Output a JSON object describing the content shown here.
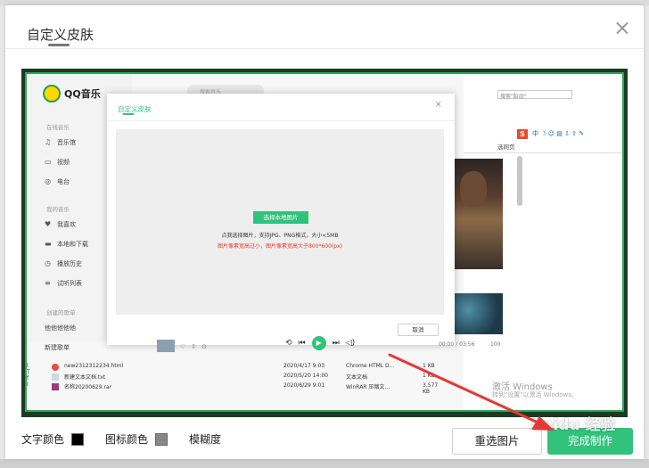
{
  "dialog": {
    "title": "自定义皮肤",
    "close_icon": "close-icon"
  },
  "preview": {
    "qq_logo_text": "QQ音乐",
    "search_placeholder": "搜索音乐",
    "sidebar": {
      "group_online": "在线音乐",
      "items_online": [
        {
          "label": "音乐馆",
          "icon": "music-note-icon"
        },
        {
          "label": "视频",
          "icon": "video-icon"
        },
        {
          "label": "电台",
          "icon": "radio-icon"
        }
      ],
      "group_mine": "我的音乐",
      "items_mine": [
        {
          "label": "我喜欢",
          "icon": "heart-icon"
        },
        {
          "label": "本地和下载",
          "icon": "computer-icon"
        },
        {
          "label": "播放历史",
          "icon": "clock-icon"
        },
        {
          "label": "试听列表",
          "icon": "list-icon"
        }
      ],
      "group_created": "创建的歌单",
      "playlist_1": "他他他他他",
      "playlist_2": "新建歌单"
    },
    "right_panel": {
      "search_text": "搜索\"胎动\"",
      "select_all": "选网页",
      "sogou": "S",
      "toolbar_text": "中 ☽ ☺ ▤ ⇩ ⇧ ✎"
    },
    "inner_modal": {
      "title": "自定义皮肤",
      "upload_button": "选择本地图片",
      "hint": "点我选择图片，支持JPG、PNG格式，大小<5MB",
      "warning": "图片像素宽高过小，图片像素宽高大于800*600(px)",
      "cancel": "取消"
    },
    "player": {
      "time": "00:00 / 03:56",
      "volume": "100"
    },
    "files": [
      {
        "name": "new2312312234.html",
        "date": "2020/4/17 9:03",
        "type": "Chrome HTML D...",
        "size": "1 KB"
      },
      {
        "name": "新建文本文档.txt",
        "date": "2020/5/20 14:00",
        "type": "文本文档",
        "size": "1 KB"
      },
      {
        "name": "名称20200629.rar",
        "date": "2020/6/29 9:01",
        "type": "WinRAR 压缩文...",
        "size": "3,577 KB"
      }
    ],
    "left_labels": [
      "l",
      "T",
      "f",
      "I"
    ],
    "activate_title": "激活 Windows",
    "activate_sub": "转到\"设置\"以激活 Windows。"
  },
  "footer": {
    "text_color_label": "文字颜色",
    "text_color": "#000000",
    "icon_color_label": "图标颜色",
    "icon_color": "#888888",
    "blur_label": "模糊度",
    "reselect_button": "重选图片",
    "done_button": "完成制作",
    "watermark": "Baidu 经验"
  },
  "colors": {
    "accent": "#31c27c",
    "warning": "#e8402a",
    "arrow": "#e53935"
  }
}
